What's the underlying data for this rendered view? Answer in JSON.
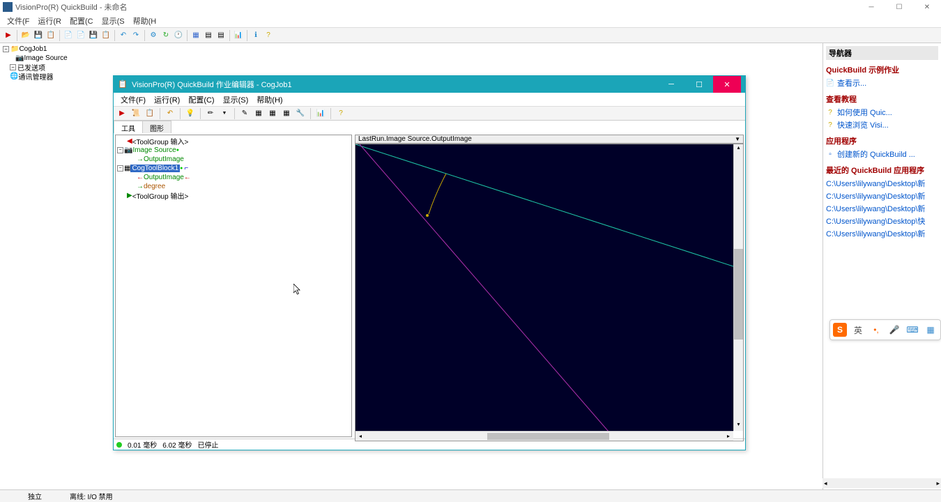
{
  "app": {
    "title": "VisionPro(R) QuickBuild - 未命名"
  },
  "menubar": {
    "file": "文件(F",
    "run": "运行(R",
    "config": "配置(C",
    "display": "显示(S",
    "help": "帮助(H"
  },
  "main_tree": {
    "root": "CogJob1",
    "image_source": "Image Source",
    "posted": "已发送项",
    "comm": "通讯管理器"
  },
  "child_window": {
    "title": "VisionPro(R) QuickBuild 作业编辑器 - CogJob1",
    "menu": {
      "file": "文件(F)",
      "run": "运行(R)",
      "config": "配置(C)",
      "display": "显示(S)",
      "help": "帮助(H)"
    },
    "tabs": {
      "tools": "工具",
      "graphics": "图形"
    },
    "tree": {
      "inputs": "<ToolGroup 输入>",
      "image_source": "Image Source",
      "output_image1": "OutputImage",
      "cog_tool_block": "CogToolBlock1",
      "output_image2": "OutputImage",
      "degree": "degree",
      "outputs": "<ToolGroup 输出>"
    },
    "image_header": "LastRun.Image Source.OutputImage",
    "status": {
      "time1": "0.01 毫秒",
      "time2": "6.02 毫秒",
      "state": "已停止"
    }
  },
  "nav_panel": {
    "header": "导航器",
    "samples_title": "QuickBuild 示例作业",
    "view_samples": "查看示...",
    "tutorials_title": "查看教程",
    "howto": "如何使用 Quic...",
    "browse": "快速浏览 Visi...",
    "apps_title": "应用程序",
    "new_app": "创建新的 QuickBuild ...",
    "recent_title": "最近的 QuickBuild 应用程序",
    "recent1": "C:\\Users\\lilywang\\Desktop\\新",
    "recent2": "C:\\Users\\lilywang\\Desktop\\新",
    "recent3": "C:\\Users\\lilywang\\Desktop\\新",
    "recent4": "C:\\Users\\lilywang\\Desktop\\快",
    "recent5": "C:\\Users\\lilywang\\Desktop\\新"
  },
  "ime": {
    "lang": "英"
  },
  "statusbar": {
    "standalone": "独立",
    "offline": "离线: I/O 禁用"
  }
}
